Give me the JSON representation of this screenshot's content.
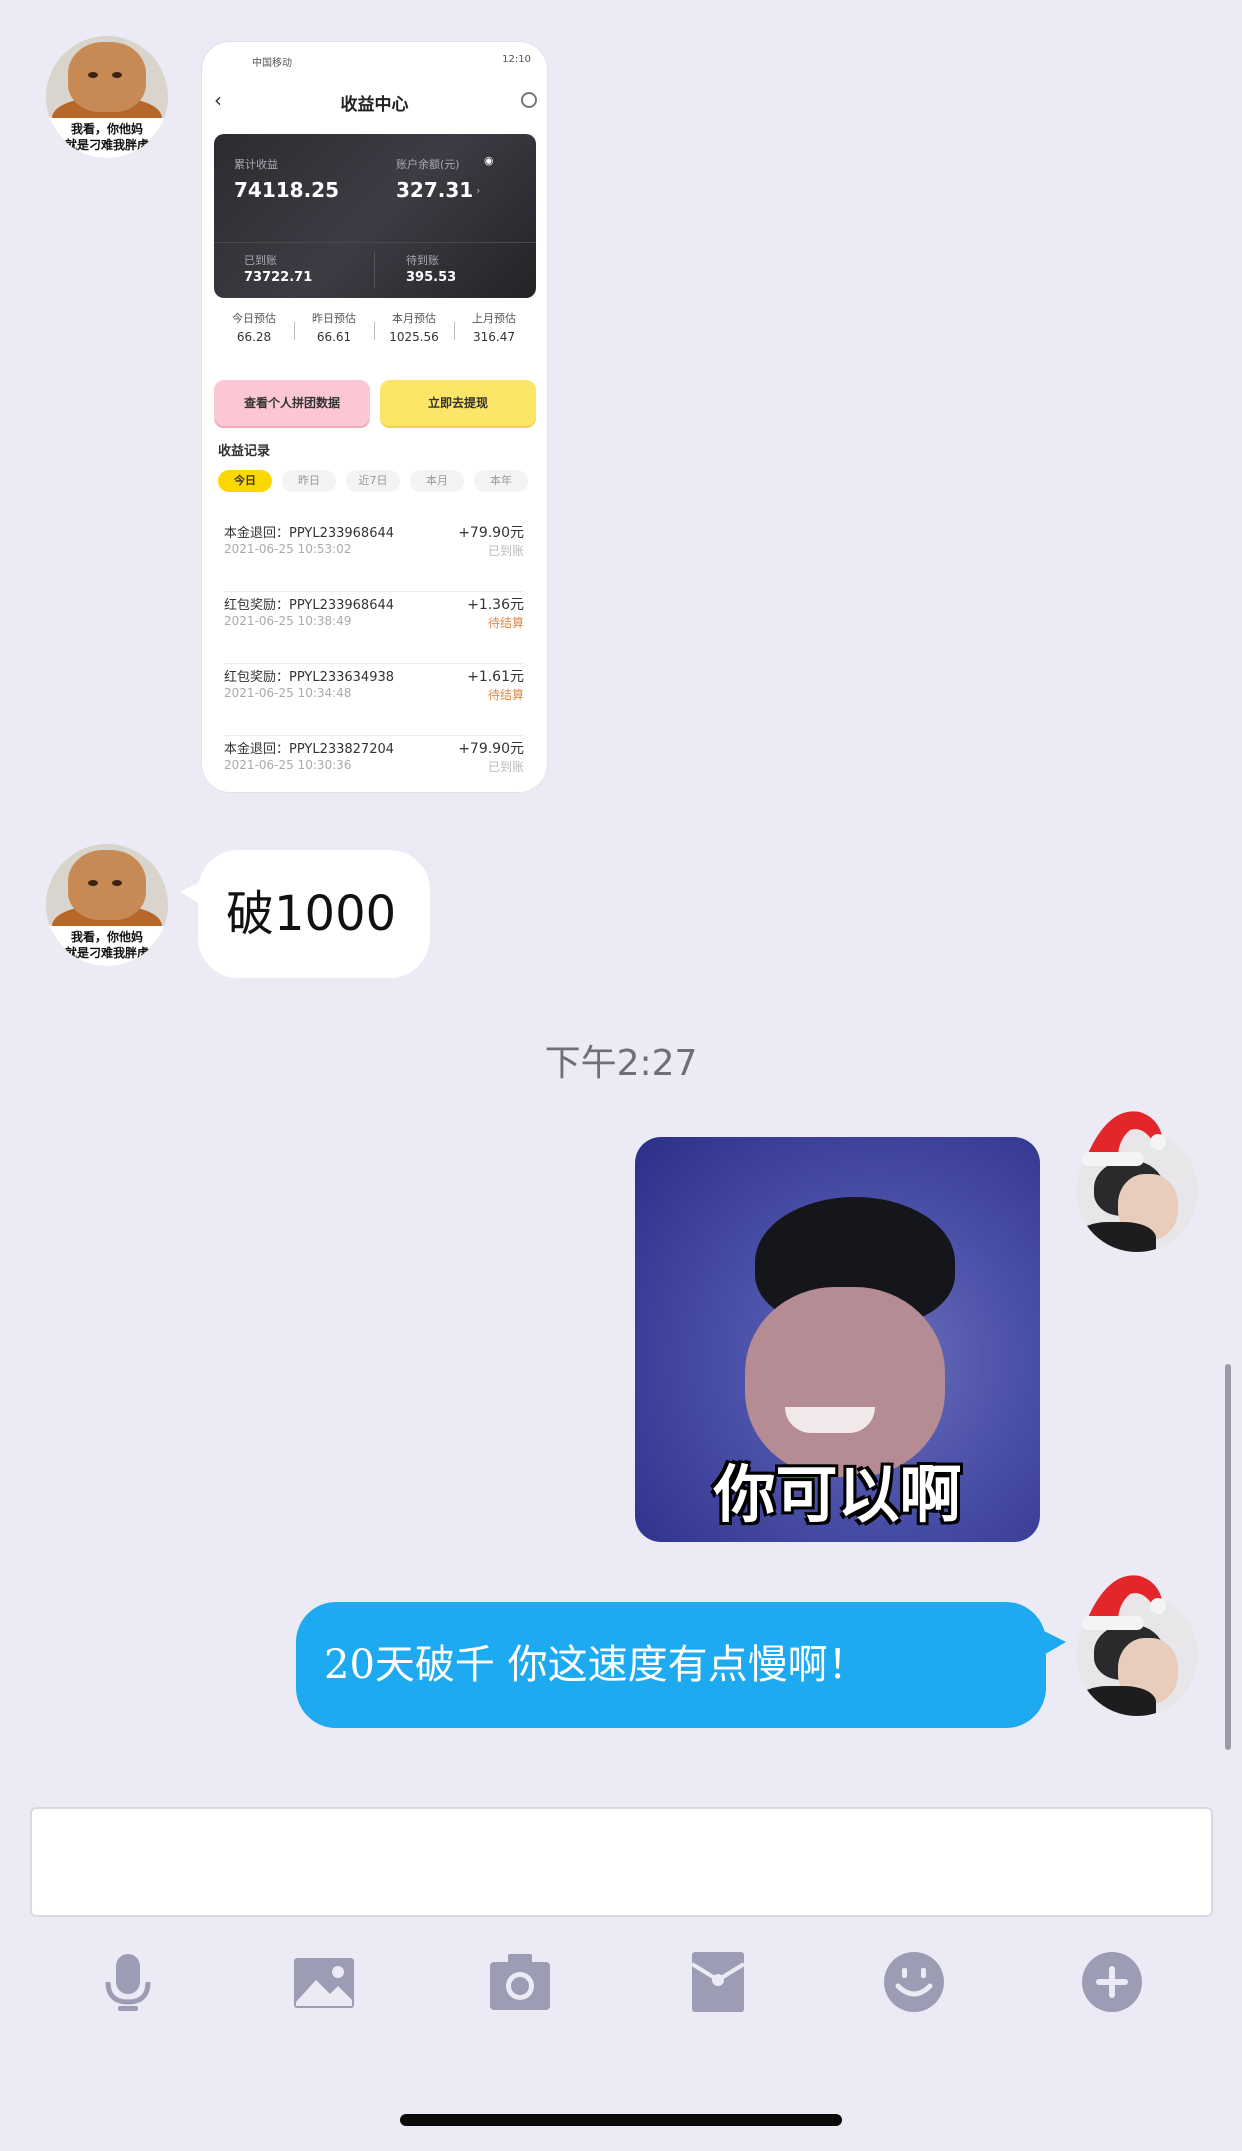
{
  "messages": {
    "left_avatar_caption": [
      "我看，你他妈",
      "就是刁难我胖虎"
    ],
    "left_text": "破1000",
    "timestamp": "下午2:27",
    "sticker_caption": "你可以啊",
    "right_text": "20天破千 你这速度有点慢啊！"
  },
  "screenshot": {
    "carrier": "中国移动",
    "time": "12:10",
    "title": "收益中心",
    "total_label": "累计收益",
    "total_value": "74118.25",
    "balance_label": "账户余额(元)",
    "balance_value": "327.31",
    "arrived_label": "已到账",
    "arrived_value": "73722.71",
    "pending_label": "待到账",
    "pending_value": "395.53",
    "stats": [
      {
        "label": "今日预估",
        "value": "66.28"
      },
      {
        "label": "昨日预估",
        "value": "66.61"
      },
      {
        "label": "本月预估",
        "value": "1025.56"
      },
      {
        "label": "上月预估",
        "value": "316.47"
      }
    ],
    "btn_group_data": "查看个人拼团数据",
    "btn_withdraw": "立即去提现",
    "records_title": "收益记录",
    "tabs": [
      "今日",
      "昨日",
      "近7日",
      "本月",
      "本年"
    ],
    "records": [
      {
        "name": "本金退回：PPYL233968644",
        "date": "2021-06-25 10:53:02",
        "amount": "+79.90元",
        "state": "已到账"
      },
      {
        "name": "红包奖励：PPYL233968644",
        "date": "2021-06-25 10:38:49",
        "amount": "+1.36元",
        "state": "待结算"
      },
      {
        "name": "红包奖励：PPYL233634938",
        "date": "2021-06-25 10:34:48",
        "amount": "+1.61元",
        "state": "待结算"
      },
      {
        "name": "本金退回：PPYL233827204",
        "date": "2021-06-25 10:30:36",
        "amount": "+79.90元",
        "state": "已到账"
      }
    ]
  },
  "toolbar": {
    "icons": [
      "microphone-icon",
      "image-icon",
      "camera-icon",
      "red-packet-icon",
      "emoji-icon",
      "plus-icon"
    ]
  },
  "colors": {
    "background": "#ecebf5",
    "right_bubble": "#1eaaf1",
    "icon": "#9c9cb4"
  }
}
